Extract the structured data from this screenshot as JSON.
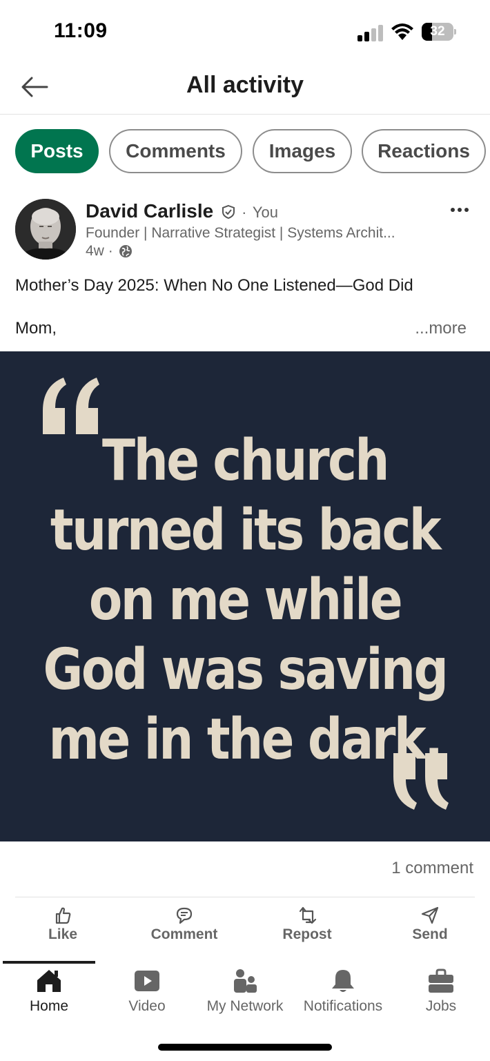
{
  "status_bar": {
    "time": "11:09",
    "battery": "32",
    "battery_fraction": 0.32
  },
  "header": {
    "title": "All activity"
  },
  "filters": [
    {
      "label": "Posts",
      "active": true
    },
    {
      "label": "Comments",
      "active": false
    },
    {
      "label": "Images",
      "active": false
    },
    {
      "label": "Reactions",
      "active": false
    }
  ],
  "post": {
    "author_name": "David Carlisle",
    "author_relation": "You",
    "author_headline": "Founder | Narrative Strategist | Systems Archit...",
    "age": "4w",
    "text_title": "Mother’s Day 2025: When No One Listened—God Did",
    "text_preview": "Mom,",
    "see_more": "...more",
    "image_quote_lines": [
      "The church",
      "turned its back",
      "on me while",
      "God was saving",
      "me in the dark."
    ],
    "comment_count": "1 comment"
  },
  "actions": [
    {
      "label": "Like",
      "icon": "thumbs-up-icon"
    },
    {
      "label": "Comment",
      "icon": "comment-icon"
    },
    {
      "label": "Repost",
      "icon": "repost-icon"
    },
    {
      "label": "Send",
      "icon": "send-icon"
    }
  ],
  "tabs": [
    {
      "label": "Home",
      "icon": "home-icon",
      "active": true
    },
    {
      "label": "Video",
      "icon": "video-icon",
      "active": false
    },
    {
      "label": "My Network",
      "icon": "network-icon",
      "active": false
    },
    {
      "label": "Notifications",
      "icon": "bell-icon",
      "active": false
    },
    {
      "label": "Jobs",
      "icon": "briefcase-icon",
      "active": false
    }
  ],
  "colors": {
    "accent_green": "#01754f",
    "image_background": "#1d2638",
    "quote_text": "#e3d9c7",
    "muted_text": "#666666"
  }
}
